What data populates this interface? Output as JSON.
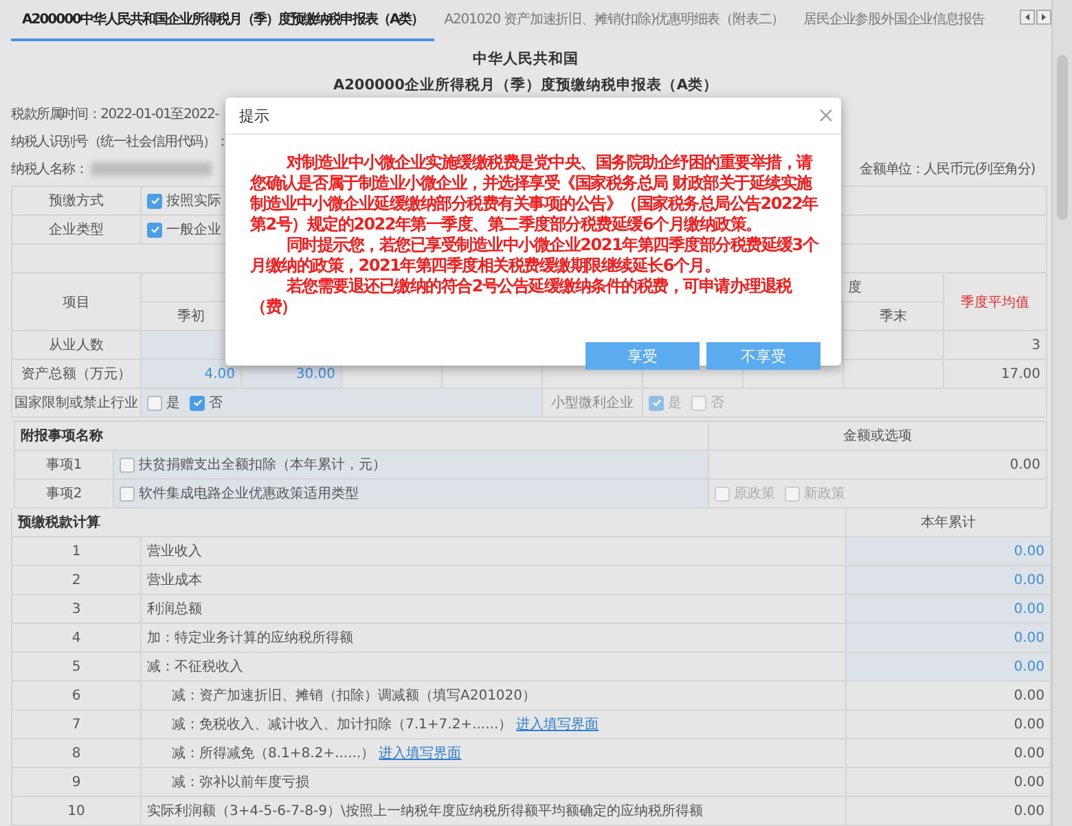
{
  "tabs": [
    {
      "label": "A200000中华人民共和国企业所得税月（季）度预缴纳税申报表（A类）",
      "selected": true
    },
    {
      "label": "A201020 资产加速折旧、摊销(扣除)优惠明细表（附表二）",
      "selected": false
    },
    {
      "label": "居民企业参股外国企业信息报告",
      "selected": false
    }
  ],
  "title": [
    "中华人民共和国",
    "A200000企业所得税月（季）度预缴纳税申报表（A类）"
  ],
  "info": [
    {
      "text": "税款所属时间：2022-01-01至2022-",
      "blurred": false
    },
    {
      "text": "纳税人识别号（统一社会信用代码）：",
      "blurred": false
    },
    {
      "text": "纳税人名称：",
      "blurred": true
    }
  ],
  "unit": "金额单位：人民币元(列至角分)",
  "basic": [
    {
      "label": "预缴方式",
      "options": [
        {
          "label": "按照实际",
          "checked": true
        }
      ]
    },
    {
      "label": "企业类型",
      "options": [
        {
          "label": "一般企业",
          "checked": true
        }
      ]
    }
  ],
  "quarters": {
    "item_head": "项目",
    "last_group_fragment": "度",
    "first_start_head": "季初",
    "last_end_head": "季末",
    "average_head": "季度平均值",
    "rows": [
      {
        "label": "从业人数",
        "average": "3"
      },
      {
        "label": "资产总额（万元）",
        "q1_start": "4.00",
        "q1_end": "30.00",
        "average": "17.00"
      }
    ]
  },
  "flags": [
    {
      "label": "国家限制或禁止行业",
      "disabled": false,
      "options": [
        {
          "label": "是",
          "checked": false
        },
        {
          "label": "否",
          "checked": true
        }
      ]
    },
    {
      "label": "小型微利企业",
      "disabled": true,
      "options": [
        {
          "label": "是",
          "checked": true
        },
        {
          "label": "否",
          "checked": false
        }
      ]
    }
  ],
  "appendix": {
    "title": "附报事项名称",
    "value_head": "金额或选项",
    "items": [
      {
        "kind": "amount",
        "label": "事项1",
        "name": "扶贫捐赠支出全额扣除（本年累计，元）",
        "checked": false,
        "value": "0.00"
      },
      {
        "kind": "choice",
        "label": "事项2",
        "name": "软件集成电路企业优惠政策适用类型",
        "checked": false,
        "choices": [
          {
            "label": "原政策",
            "checked": false
          },
          {
            "label": "新政策",
            "checked": false
          }
        ]
      }
    ]
  },
  "calc": {
    "title": "预缴税款计算",
    "value_head": "本年累计",
    "rows": [
      {
        "no": "1",
        "kind": "main",
        "text": "营业收入",
        "editable": true,
        "value": "0.00"
      },
      {
        "no": "2",
        "kind": "main",
        "text": "营业成本",
        "editable": true,
        "value": "0.00"
      },
      {
        "no": "3",
        "kind": "main",
        "text": "利润总额",
        "editable": true,
        "value": "0.00"
      },
      {
        "no": "4",
        "kind": "main",
        "text": "加：特定业务计算的应纳税所得额",
        "editable": true,
        "value": "0.00"
      },
      {
        "no": "5",
        "kind": "main",
        "text": "减：不征税收入",
        "editable": true,
        "value": "0.00"
      },
      {
        "no": "6",
        "kind": "sub",
        "text": "减：资产加速折旧、摊销（扣除）调减额（填写A201020）",
        "editable": false,
        "value": "0.00"
      },
      {
        "no": "7",
        "kind": "sub",
        "text": "减：免税收入、减计收入、加计扣除（7.1+7.2+......）",
        "link": "进入填写界面",
        "editable": false,
        "value": "0.00"
      },
      {
        "no": "8",
        "kind": "sub",
        "text": "减：所得减免（8.1+8.2+......）",
        "link": "进入填写界面",
        "editable": false,
        "value": "0.00"
      },
      {
        "no": "9",
        "kind": "sub",
        "text": "减：弥补以前年度亏损",
        "editable": false,
        "value": "0.00"
      },
      {
        "no": "10",
        "kind": "main",
        "text": "实际利润额（3+4-5-6-7-8-9）\\按照上一纳税年度应纳税所得额平均额确定的应纳税所得额",
        "editable": false,
        "value": "0.00"
      }
    ]
  },
  "dialog": {
    "title": "提示",
    "paragraphs": [
      "对制造业中小微企业实施缓缴税费是党中央、国务院助企纾困的重要举措，请您确认是否属于制造业小微企业，并选择享受《国家税务总局 财政部关于延续实施制造业中小微企业延缓缴纳部分税费有关事项的公告》（国家税务总局公告2022年第2号）规定的2022年第一季度、第二季度部分税费延缓6个月缴纳政策。",
      "同时提示您，若您已享受制造业中小微企业2021年第四季度部分税费延缓3个月缴纳的政策，2021年第四季度相关税费缓缴期限继续延长6个月。",
      "若您需要退还已缴纳的符合2号公告延缓缴纳条件的税费，可申请办理退税（费）"
    ],
    "buttons": [
      "享受",
      "不享受"
    ]
  }
}
